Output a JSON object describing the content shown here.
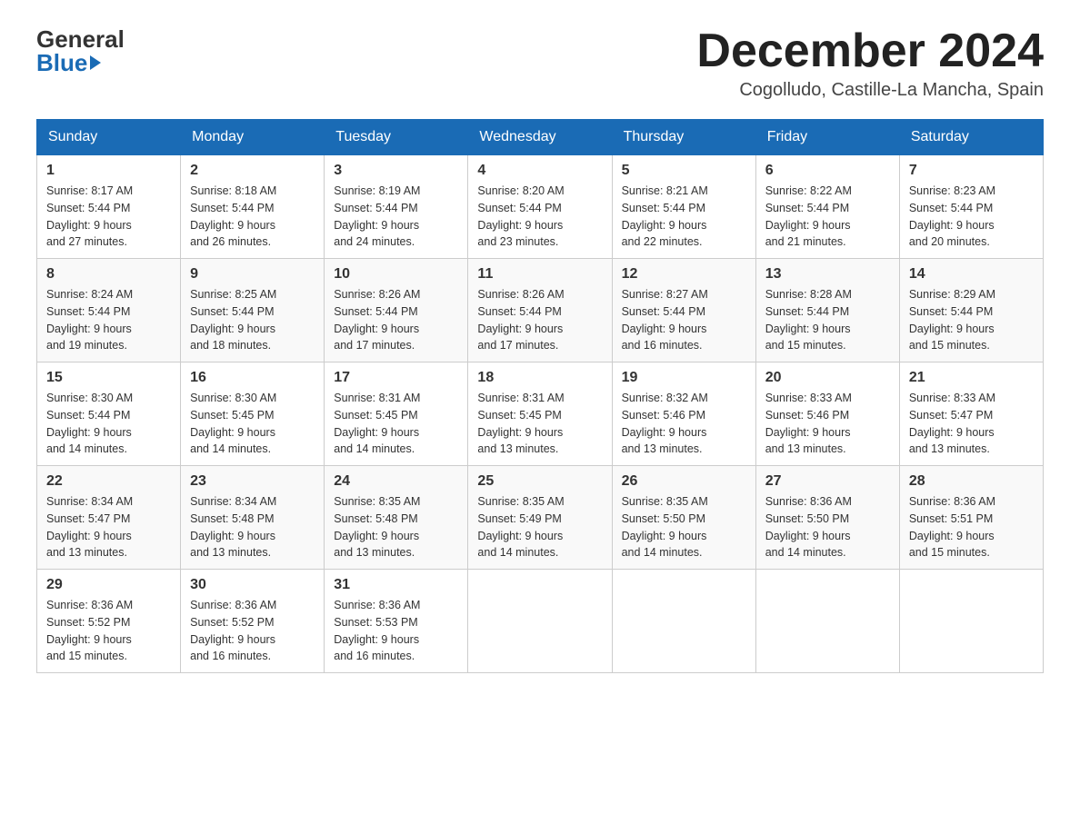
{
  "header": {
    "logo": {
      "general": "General",
      "blue": "Blue",
      "arrow_shape": "right-triangle"
    },
    "title": "December 2024",
    "location": "Cogolludo, Castille-La Mancha, Spain"
  },
  "calendar": {
    "days_of_week": [
      "Sunday",
      "Monday",
      "Tuesday",
      "Wednesday",
      "Thursday",
      "Friday",
      "Saturday"
    ],
    "weeks": [
      [
        {
          "day": "1",
          "sunrise": "8:17 AM",
          "sunset": "5:44 PM",
          "daylight": "9 hours and 27 minutes."
        },
        {
          "day": "2",
          "sunrise": "8:18 AM",
          "sunset": "5:44 PM",
          "daylight": "9 hours and 26 minutes."
        },
        {
          "day": "3",
          "sunrise": "8:19 AM",
          "sunset": "5:44 PM",
          "daylight": "9 hours and 24 minutes."
        },
        {
          "day": "4",
          "sunrise": "8:20 AM",
          "sunset": "5:44 PM",
          "daylight": "9 hours and 23 minutes."
        },
        {
          "day": "5",
          "sunrise": "8:21 AM",
          "sunset": "5:44 PM",
          "daylight": "9 hours and 22 minutes."
        },
        {
          "day": "6",
          "sunrise": "8:22 AM",
          "sunset": "5:44 PM",
          "daylight": "9 hours and 21 minutes."
        },
        {
          "day": "7",
          "sunrise": "8:23 AM",
          "sunset": "5:44 PM",
          "daylight": "9 hours and 20 minutes."
        }
      ],
      [
        {
          "day": "8",
          "sunrise": "8:24 AM",
          "sunset": "5:44 PM",
          "daylight": "9 hours and 19 minutes."
        },
        {
          "day": "9",
          "sunrise": "8:25 AM",
          "sunset": "5:44 PM",
          "daylight": "9 hours and 18 minutes."
        },
        {
          "day": "10",
          "sunrise": "8:26 AM",
          "sunset": "5:44 PM",
          "daylight": "9 hours and 17 minutes."
        },
        {
          "day": "11",
          "sunrise": "8:26 AM",
          "sunset": "5:44 PM",
          "daylight": "9 hours and 17 minutes."
        },
        {
          "day": "12",
          "sunrise": "8:27 AM",
          "sunset": "5:44 PM",
          "daylight": "9 hours and 16 minutes."
        },
        {
          "day": "13",
          "sunrise": "8:28 AM",
          "sunset": "5:44 PM",
          "daylight": "9 hours and 15 minutes."
        },
        {
          "day": "14",
          "sunrise": "8:29 AM",
          "sunset": "5:44 PM",
          "daylight": "9 hours and 15 minutes."
        }
      ],
      [
        {
          "day": "15",
          "sunrise": "8:30 AM",
          "sunset": "5:44 PM",
          "daylight": "9 hours and 14 minutes."
        },
        {
          "day": "16",
          "sunrise": "8:30 AM",
          "sunset": "5:45 PM",
          "daylight": "9 hours and 14 minutes."
        },
        {
          "day": "17",
          "sunrise": "8:31 AM",
          "sunset": "5:45 PM",
          "daylight": "9 hours and 14 minutes."
        },
        {
          "day": "18",
          "sunrise": "8:31 AM",
          "sunset": "5:45 PM",
          "daylight": "9 hours and 13 minutes."
        },
        {
          "day": "19",
          "sunrise": "8:32 AM",
          "sunset": "5:46 PM",
          "daylight": "9 hours and 13 minutes."
        },
        {
          "day": "20",
          "sunrise": "8:33 AM",
          "sunset": "5:46 PM",
          "daylight": "9 hours and 13 minutes."
        },
        {
          "day": "21",
          "sunrise": "8:33 AM",
          "sunset": "5:47 PM",
          "daylight": "9 hours and 13 minutes."
        }
      ],
      [
        {
          "day": "22",
          "sunrise": "8:34 AM",
          "sunset": "5:47 PM",
          "daylight": "9 hours and 13 minutes."
        },
        {
          "day": "23",
          "sunrise": "8:34 AM",
          "sunset": "5:48 PM",
          "daylight": "9 hours and 13 minutes."
        },
        {
          "day": "24",
          "sunrise": "8:35 AM",
          "sunset": "5:48 PM",
          "daylight": "9 hours and 13 minutes."
        },
        {
          "day": "25",
          "sunrise": "8:35 AM",
          "sunset": "5:49 PM",
          "daylight": "9 hours and 14 minutes."
        },
        {
          "day": "26",
          "sunrise": "8:35 AM",
          "sunset": "5:50 PM",
          "daylight": "9 hours and 14 minutes."
        },
        {
          "day": "27",
          "sunrise": "8:36 AM",
          "sunset": "5:50 PM",
          "daylight": "9 hours and 14 minutes."
        },
        {
          "day": "28",
          "sunrise": "8:36 AM",
          "sunset": "5:51 PM",
          "daylight": "9 hours and 15 minutes."
        }
      ],
      [
        {
          "day": "29",
          "sunrise": "8:36 AM",
          "sunset": "5:52 PM",
          "daylight": "9 hours and 15 minutes."
        },
        {
          "day": "30",
          "sunrise": "8:36 AM",
          "sunset": "5:52 PM",
          "daylight": "9 hours and 16 minutes."
        },
        {
          "day": "31",
          "sunrise": "8:36 AM",
          "sunset": "5:53 PM",
          "daylight": "9 hours and 16 minutes."
        },
        null,
        null,
        null,
        null
      ]
    ],
    "sunrise_label": "Sunrise:",
    "sunset_label": "Sunset:",
    "daylight_label": "Daylight:"
  }
}
